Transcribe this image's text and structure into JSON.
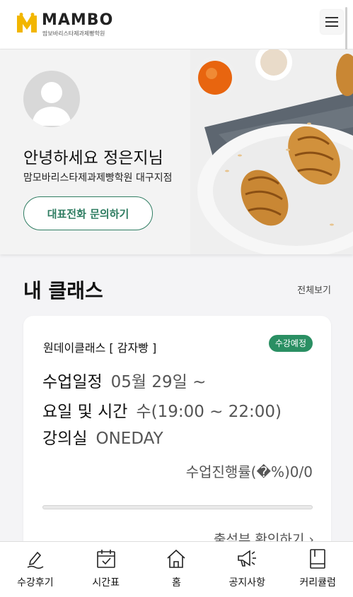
{
  "header": {
    "logo_text": "MAMBO",
    "logo_subtitle": "맘보바리스타제과제빵학원"
  },
  "hero": {
    "greeting": "안녕하세요 정은지님",
    "branch": "맘모바리스타제과제빵학원 대구지점",
    "call_button": "대표전화 문의하기"
  },
  "my_class": {
    "title": "내 클래스",
    "view_all": "전체보기",
    "card": {
      "class_name": "원데이클래스 [ 감자빵 ]",
      "status_badge": "수강예정",
      "schedule_label": "수업일정",
      "schedule_value": "05월 29일 ~",
      "day_time_label": "요일 및 시간",
      "day_time_value": "수(19:00 ~ 22:00)",
      "classroom_label": "강의실",
      "classroom_value": "ONEDAY",
      "progress_text": "수업진행률(�%)0/0",
      "progress_fraction": 0,
      "attendance_link": "출석부 확인하기 ›"
    }
  },
  "bottom_nav": {
    "items": [
      {
        "label": "수강후기",
        "icon": "pen-icon"
      },
      {
        "label": "시간표",
        "icon": "calendar-icon"
      },
      {
        "label": "홈",
        "icon": "home-icon"
      },
      {
        "label": "공지사항",
        "icon": "megaphone-icon"
      },
      {
        "label": "커리큘럼",
        "icon": "book-icon"
      }
    ]
  },
  "colors": {
    "accent_green": "#2a8f63",
    "logo_yellow": "#f2b600"
  }
}
